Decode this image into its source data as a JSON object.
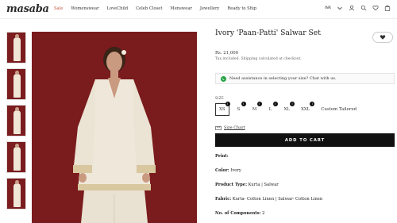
{
  "header": {
    "logo": "masaba",
    "nav": [
      "Sale",
      "Womenswear",
      "LoveChild",
      "Celeb Closet",
      "Menswear",
      "Jewellery",
      "Ready to Ship"
    ],
    "currency": "INR",
    "icons": [
      "chevron-down-icon",
      "user-icon",
      "search-icon",
      "heart-icon",
      "bag-icon"
    ]
  },
  "product": {
    "title": "Ivory 'Paan-Patti' Salwar Set",
    "price": "Rs. 21,000",
    "tax_note": "Tax included. Shipping calculated at checkout.",
    "assist_text": "Need assistance in selecting your size? Chat with us.",
    "size_label": "SIZE",
    "sizes": [
      "XS",
      "S",
      "M",
      "L",
      "XL",
      "XXL",
      "Custom Tailored"
    ],
    "selected_size": "XS",
    "size_chart": "Size Chart",
    "add_to_cart": "ADD TO CART",
    "specs": {
      "print_label": "Print:",
      "print_value": "",
      "color_label": "Color:",
      "color_value": "Ivory",
      "type_label": "Product Type:",
      "type_value": "Kurta | Salwar",
      "fabric_label": "Fabric:",
      "fabric_value": "Kurta- Cotton Linen | Salwar- Cotton Linen",
      "components_label": "No. of Components:",
      "components_value": "2"
    }
  },
  "colors": {
    "accent_sale": "#c8503c",
    "background_image": "#7a1b1d",
    "button": "#111111",
    "whatsapp": "#25a244"
  }
}
